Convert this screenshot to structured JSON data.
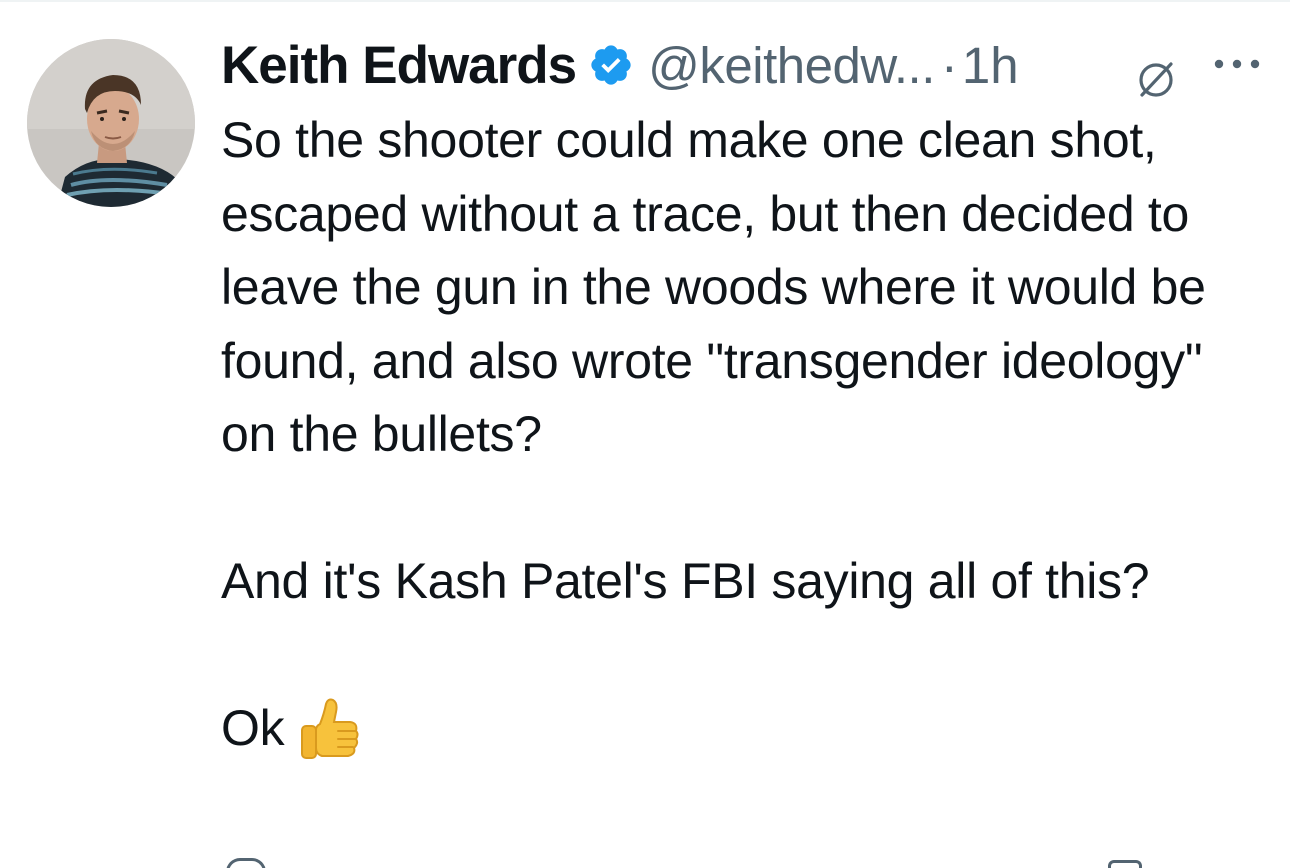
{
  "tweet": {
    "author": {
      "display_name": "Keith Edwards",
      "verified": true,
      "handle": "@keithedw...",
      "separator": "·",
      "time": "1h"
    },
    "icons": {
      "avatar": "profile-photo",
      "verified": "verified-badge-icon",
      "grok": "grok-icon",
      "more": "more-options-icon",
      "emoji": "thumbs-up-emoji"
    },
    "text": {
      "paragraph_1": "So the shooter could make one clean shot, escaped without a trace, but then decided to leave the gun in the woods where it would be found, and also wrote \"transgender ideology\" on the bullets?",
      "paragraph_2": "And it's Kash Patel's FBI saying all of this?",
      "paragraph_3": "Ok"
    },
    "colors": {
      "text": "#0f1419",
      "secondary": "#536471",
      "verified": "#1d9bf0"
    }
  }
}
